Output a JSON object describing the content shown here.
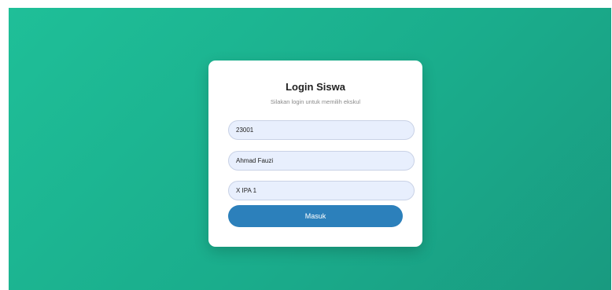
{
  "login": {
    "title": "Login Siswa",
    "subtitle": "Silakan login untuk memilih ekskul",
    "fields": [
      {
        "value": "23001"
      },
      {
        "value": "Ahmad Fauzi"
      },
      {
        "value": "X IPA 1"
      }
    ],
    "submit_label": "Masuk"
  },
  "colors": {
    "background_gradient_start": "#1fbf98",
    "background_gradient_end": "#199a80",
    "input_background": "#e8effd",
    "button": "#2c80bb"
  }
}
